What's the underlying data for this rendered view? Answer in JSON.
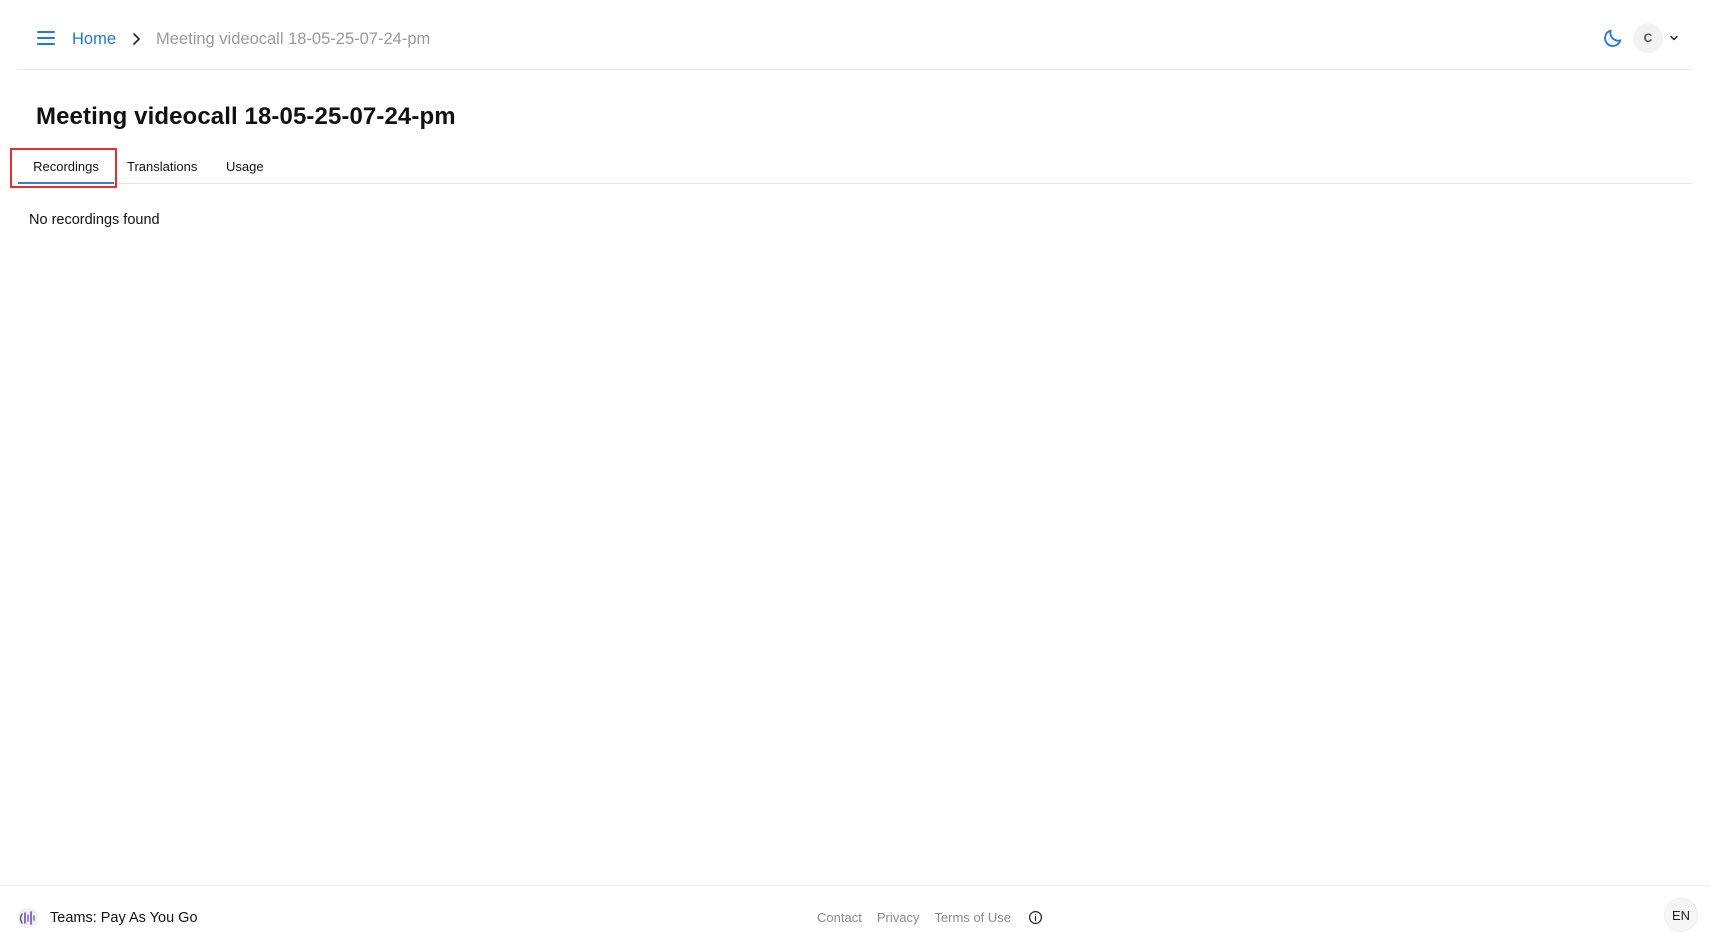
{
  "header": {
    "menu_icon": "hamburger-menu-icon",
    "breadcrumb": {
      "home_label": "Home",
      "separator_icon": "chevron-right-icon",
      "current_label": "Meeting videocall 18-05-25-07-24-pm"
    },
    "theme_icon": "moon-icon",
    "user": {
      "avatar_initial": "C",
      "dropdown_icon": "chevron-down-icon"
    }
  },
  "page": {
    "title": "Meeting videocall 18-05-25-07-24-pm",
    "tabs": [
      {
        "label": "Recordings",
        "active": true
      },
      {
        "label": "Translations",
        "active": false
      },
      {
        "label": "Usage",
        "active": false
      }
    ],
    "empty_message": "No recordings found"
  },
  "footer": {
    "brand_label": "Teams: Pay As You Go",
    "links": [
      {
        "label": "Contact"
      },
      {
        "label": "Privacy"
      },
      {
        "label": "Terms of Use"
      }
    ],
    "info_icon": "info-circle-icon",
    "language": "EN"
  },
  "colors": {
    "accent": "#1e7bd6",
    "tab_underline": "#2f7fe0",
    "highlight_box": "#e03030",
    "muted_text": "#9a9a9a"
  }
}
